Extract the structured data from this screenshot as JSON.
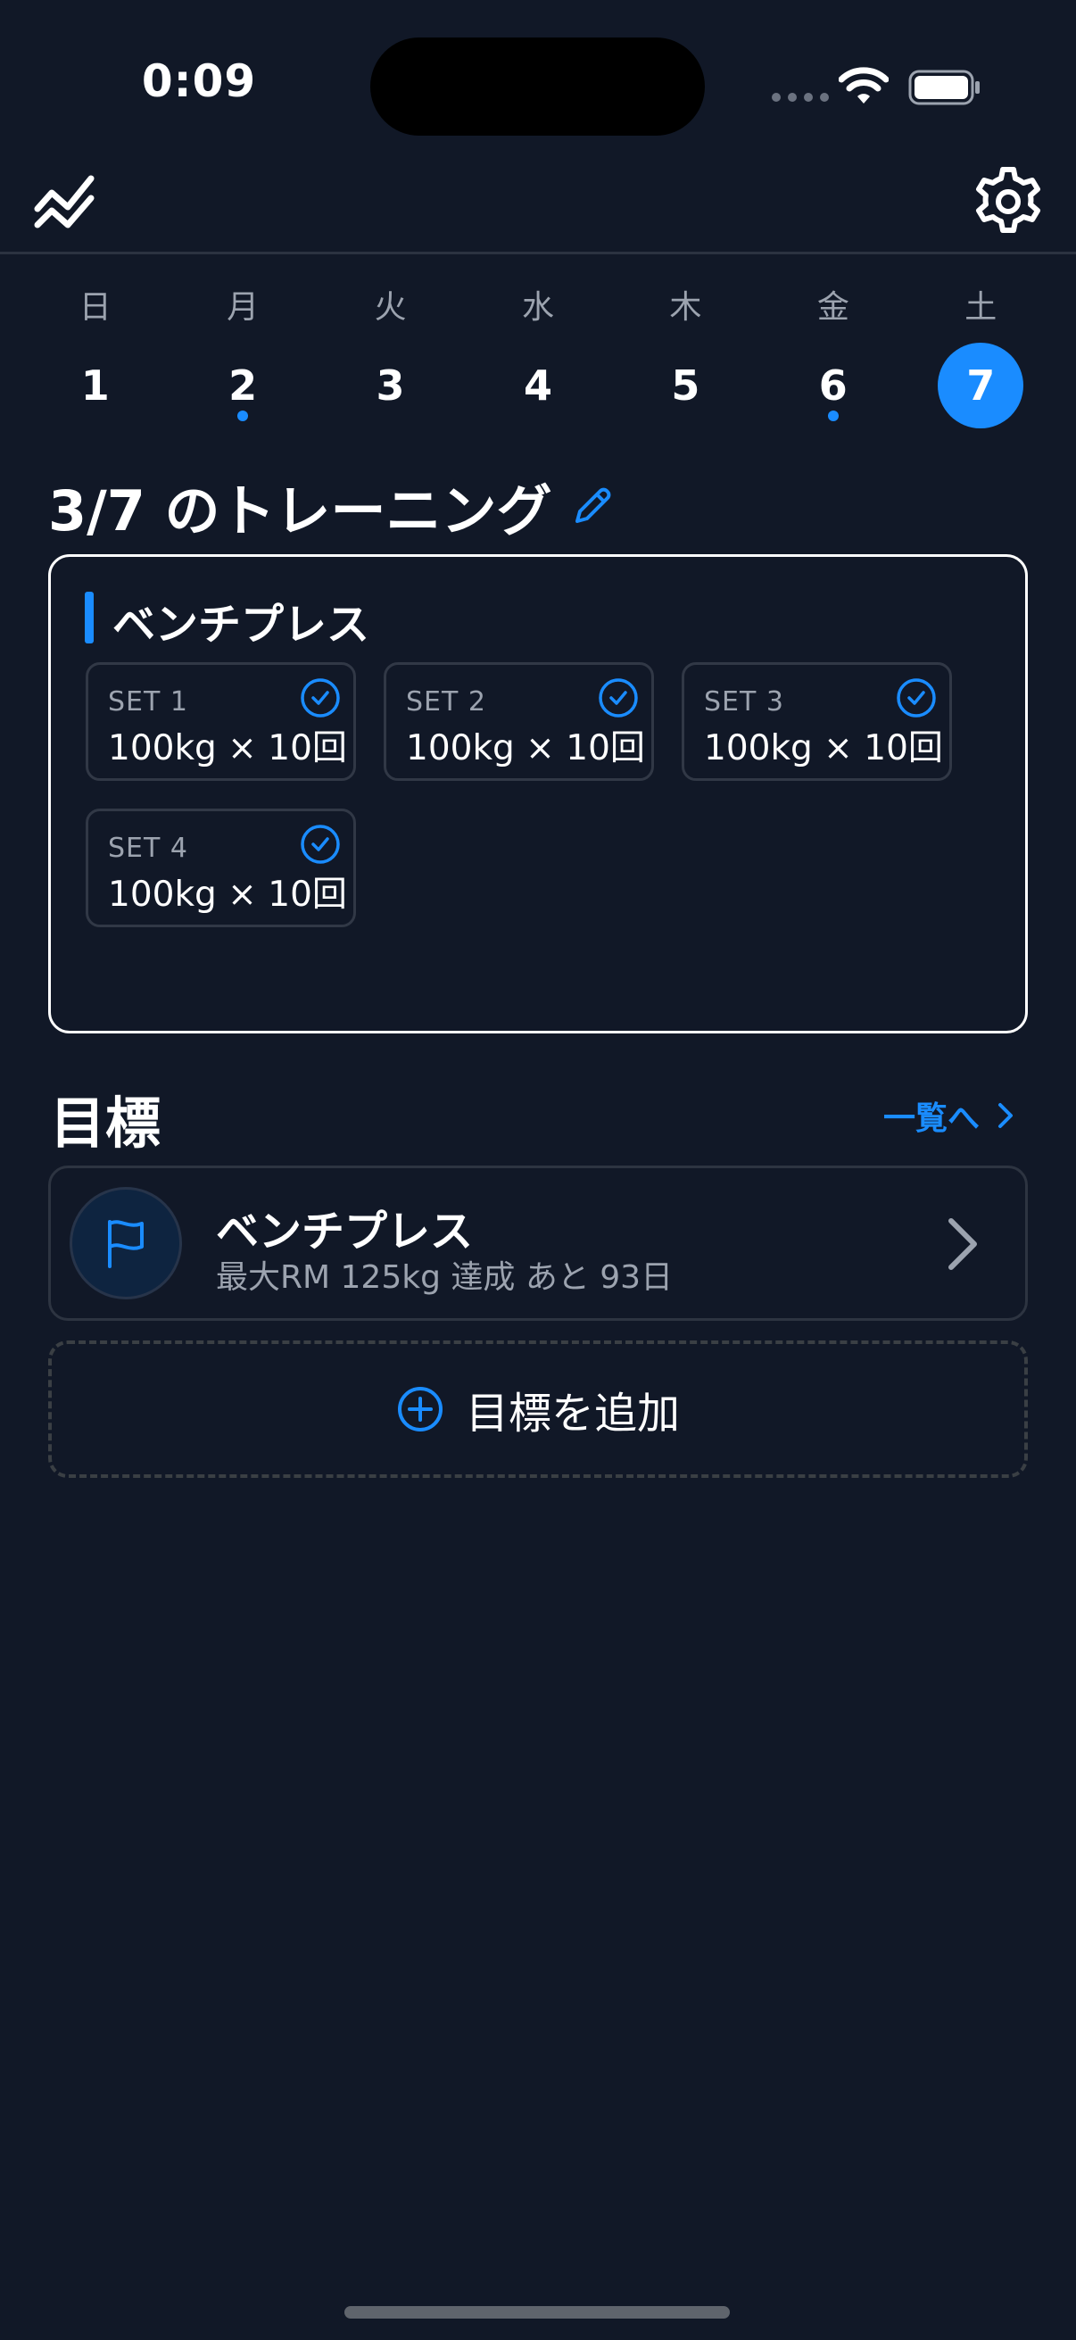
{
  "status_bar": {
    "time": "0:09"
  },
  "week": {
    "days": [
      {
        "dow": "日",
        "num": "1",
        "dot": false,
        "selected": false
      },
      {
        "dow": "月",
        "num": "2",
        "dot": true,
        "selected": false
      },
      {
        "dow": "火",
        "num": "3",
        "dot": false,
        "selected": false
      },
      {
        "dow": "水",
        "num": "4",
        "dot": false,
        "selected": false
      },
      {
        "dow": "木",
        "num": "5",
        "dot": false,
        "selected": false
      },
      {
        "dow": "金",
        "num": "6",
        "dot": true,
        "selected": false
      },
      {
        "dow": "土",
        "num": "7",
        "dot": false,
        "selected": true
      }
    ]
  },
  "training": {
    "title": "3/7 のトレーニング",
    "exercise": {
      "name": "ベンチプレス",
      "sets": [
        {
          "label": "SET 1",
          "value": "100kg × 10回",
          "done": true
        },
        {
          "label": "SET 2",
          "value": "100kg × 10回",
          "done": true
        },
        {
          "label": "SET 3",
          "value": "100kg × 10回",
          "done": true
        },
        {
          "label": "SET 4",
          "value": "100kg × 10回",
          "done": true
        }
      ]
    }
  },
  "goals": {
    "title": "目標",
    "link_label": "一覧へ",
    "items": [
      {
        "name": "ベンチプレス",
        "detail": "最大RM 125kg 達成 あと 93日"
      }
    ],
    "add_label": "目標を追加"
  },
  "colors": {
    "background": "#111827",
    "accent": "#1a8cff",
    "muted_text": "#9ca3af"
  },
  "icons": {
    "nav_left": "chart-line-icon",
    "nav_right": "gear-icon",
    "title_edit": "pencil-icon",
    "set_done": "check-circle-icon",
    "goal": "flag-icon",
    "goal_open": "chevron-right-icon",
    "add": "plus-circle-icon"
  }
}
